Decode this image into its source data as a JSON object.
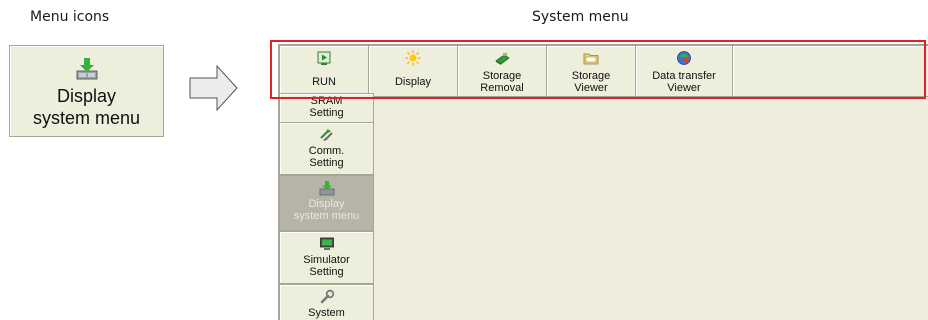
{
  "captions": {
    "left": "Menu icons",
    "right": "System menu"
  },
  "menu_icon": {
    "label_line1": "Display",
    "label_line2": "system menu",
    "icon": "display-system-menu-icon"
  },
  "toolbar": {
    "items": [
      {
        "line1": "RUN",
        "line2": "",
        "icon": "run-icon"
      },
      {
        "line1": "Display",
        "line2": "",
        "icon": "sun-icon"
      },
      {
        "line1": "Storage",
        "line2": "Removal",
        "icon": "storage-removal-icon"
      },
      {
        "line1": "Storage",
        "line2": "Viewer",
        "icon": "folder-icon"
      },
      {
        "line1": "Data transfer",
        "line2": "Viewer",
        "icon": "data-transfer-icon"
      }
    ]
  },
  "sidebar": {
    "items": [
      {
        "line1": "SRAM",
        "line2": "Setting",
        "icon": "",
        "active": false
      },
      {
        "line1": "Comm.",
        "line2": "Setting",
        "icon": "comm-icon",
        "active": false
      },
      {
        "line1": "Display",
        "line2": "system menu",
        "icon": "display-system-menu-icon",
        "active": true
      },
      {
        "line1": "Simulator",
        "line2": "Setting",
        "icon": "simulator-icon",
        "active": false
      },
      {
        "line1": "System",
        "line2": "",
        "icon": "wrench-icon",
        "active": false
      }
    ]
  },
  "colors": {
    "panel_bg": "#eeeedc",
    "active_bg": "#b5b4a6",
    "highlight": "#e2202a"
  }
}
